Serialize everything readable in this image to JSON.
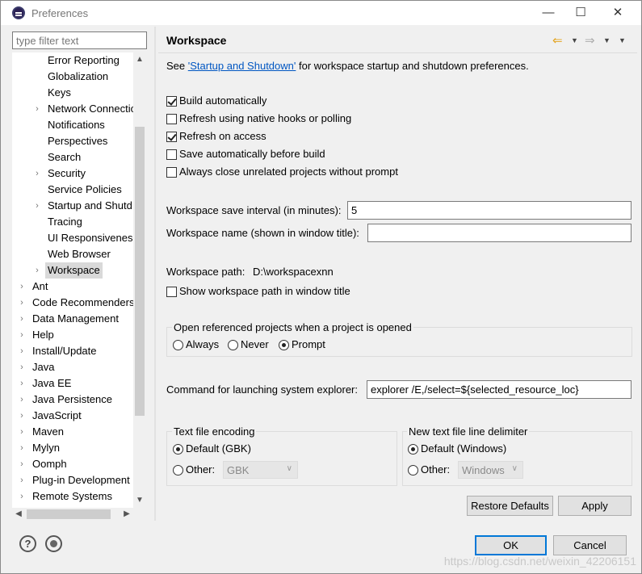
{
  "window": {
    "title": "Preferences"
  },
  "filter": {
    "placeholder": "type filter text"
  },
  "tree": {
    "items": [
      {
        "label": "Error Reporting",
        "arrow": false
      },
      {
        "label": "Globalization",
        "arrow": false
      },
      {
        "label": "Keys",
        "arrow": false
      },
      {
        "label": "Network Connectio",
        "arrow": true
      },
      {
        "label": "Notifications",
        "arrow": false
      },
      {
        "label": "Perspectives",
        "arrow": false
      },
      {
        "label": "Search",
        "arrow": false
      },
      {
        "label": "Security",
        "arrow": true
      },
      {
        "label": "Service Policies",
        "arrow": false
      },
      {
        "label": "Startup and Shutd",
        "arrow": true
      },
      {
        "label": "Tracing",
        "arrow": false
      },
      {
        "label": "UI Responsiveness",
        "arrow": false
      },
      {
        "label": "Web Browser",
        "arrow": false
      },
      {
        "label": "Workspace",
        "arrow": true,
        "selected": true
      },
      {
        "label": "Ant",
        "arrow": true,
        "top": true
      },
      {
        "label": "Code Recommenders",
        "arrow": true,
        "top": true
      },
      {
        "label": "Data Management",
        "arrow": true,
        "top": true
      },
      {
        "label": "Help",
        "arrow": true,
        "top": true
      },
      {
        "label": "Install/Update",
        "arrow": true,
        "top": true
      },
      {
        "label": "Java",
        "arrow": true,
        "top": true
      },
      {
        "label": "Java EE",
        "arrow": true,
        "top": true
      },
      {
        "label": "Java Persistence",
        "arrow": true,
        "top": true
      },
      {
        "label": "JavaScript",
        "arrow": true,
        "top": true
      },
      {
        "label": "Maven",
        "arrow": true,
        "top": true
      },
      {
        "label": "Mylyn",
        "arrow": true,
        "top": true
      },
      {
        "label": "Oomph",
        "arrow": true,
        "top": true
      },
      {
        "label": "Plug-in Development",
        "arrow": true,
        "top": true
      },
      {
        "label": "Remote Systems",
        "arrow": true,
        "top": true
      }
    ]
  },
  "page": {
    "title": "Workspace",
    "desc_prefix": "See ",
    "desc_link": "'Startup and Shutdown'",
    "desc_suffix": " for workspace startup and shutdown preferences.",
    "checkboxes": [
      {
        "label": "Build automatically",
        "checked": true
      },
      {
        "label": "Refresh using native hooks or polling",
        "checked": false
      },
      {
        "label": "Refresh on access",
        "checked": true
      },
      {
        "label": "Save automatically before build",
        "checked": false
      },
      {
        "label": "Always close unrelated projects without prompt",
        "checked": false
      }
    ],
    "save_interval_label": "Workspace save interval (in minutes):",
    "save_interval_value": "5",
    "ws_name_label": "Workspace name (shown in window title):",
    "ws_name_value": "",
    "ws_path_label": "Workspace path:",
    "ws_path_value": "D:\\workspacexnn",
    "show_path_label": "Show workspace path in window title",
    "open_ref_group": "Open referenced projects when a project is opened",
    "open_ref_options": [
      "Always",
      "Never",
      "Prompt"
    ],
    "open_ref_selected": "Prompt",
    "cmd_label": "Command for launching system explorer:",
    "cmd_value": "explorer /E,/select=${selected_resource_loc}",
    "encoding_group": "Text file encoding",
    "encoding_default": "Default (GBK)",
    "encoding_other": "Other:",
    "encoding_other_value": "GBK",
    "delimiter_group": "New text file line delimiter",
    "delimiter_default": "Default (Windows)",
    "delimiter_other": "Other:",
    "delimiter_other_value": "Windows",
    "restore_defaults": "Restore Defaults",
    "apply": "Apply"
  },
  "footer": {
    "ok": "OK",
    "cancel": "Cancel",
    "help_glyph": "?"
  },
  "watermark": "https://blog.csdn.net/weixin_42206151",
  "colors": {
    "link": "#0056c2",
    "primary_border": "#0078d7",
    "back_arrow": "#e3a21a"
  }
}
